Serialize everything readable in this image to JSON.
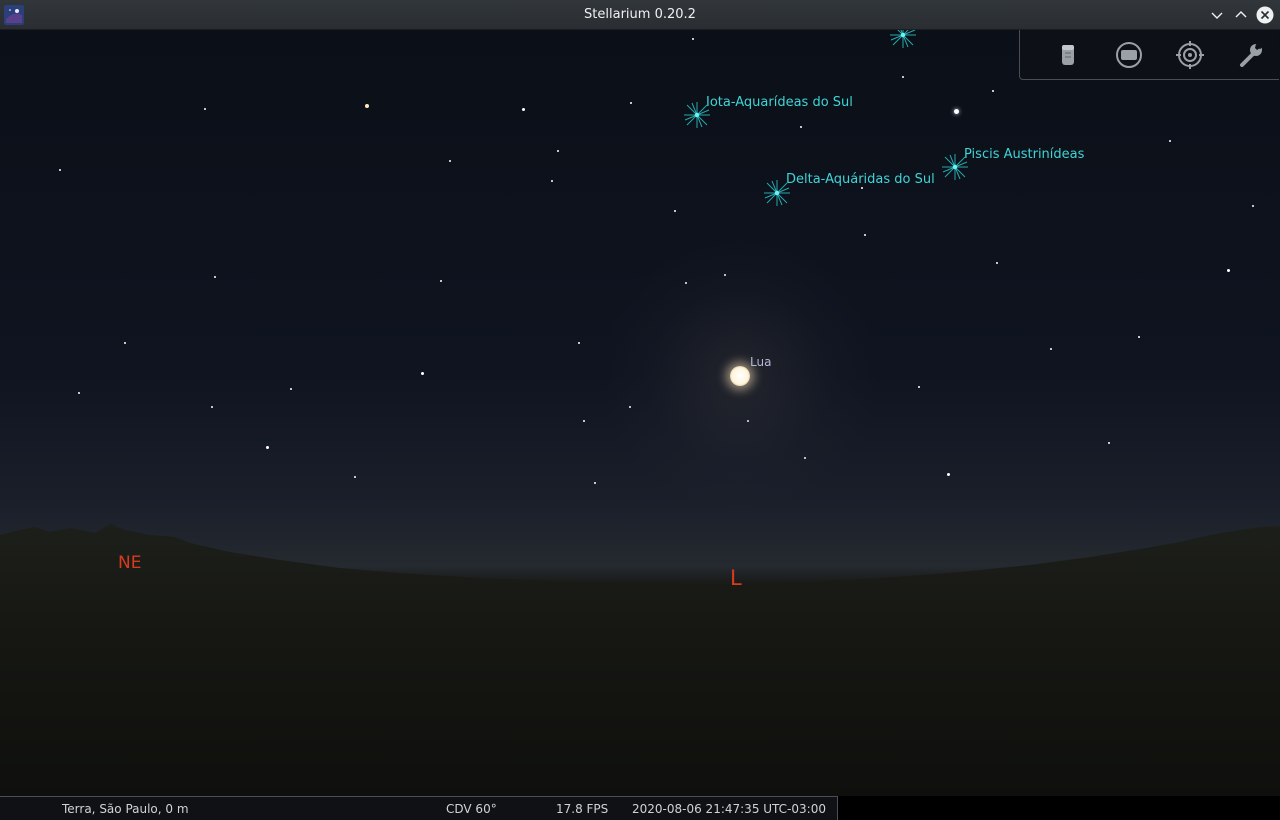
{
  "window": {
    "title": "Stellarium 0.20.2"
  },
  "sky": {
    "meteor_showers": [
      "Iota-Aquarídeas do Sul",
      "Piscis Austrinídeas",
      "Delta-Aquáridas do Sul"
    ],
    "moon_label": "Lua",
    "cardinals": {
      "northeast": "NE",
      "east": "L"
    }
  },
  "toolbar": {
    "icons": [
      "telescope-icon",
      "screen-icon",
      "target-icon",
      "wrench-icon"
    ]
  },
  "status": {
    "location": "Terra, São Paulo, 0 m",
    "fov": "CDV 60°",
    "fps": "17.8 FPS",
    "datetime": "2020-08-06 21:47:35 UTC-03:00"
  },
  "colors": {
    "shower_label": "#3fd4d6",
    "cardinal": "#d83a1f",
    "moon_label": "#b5b8d8"
  }
}
